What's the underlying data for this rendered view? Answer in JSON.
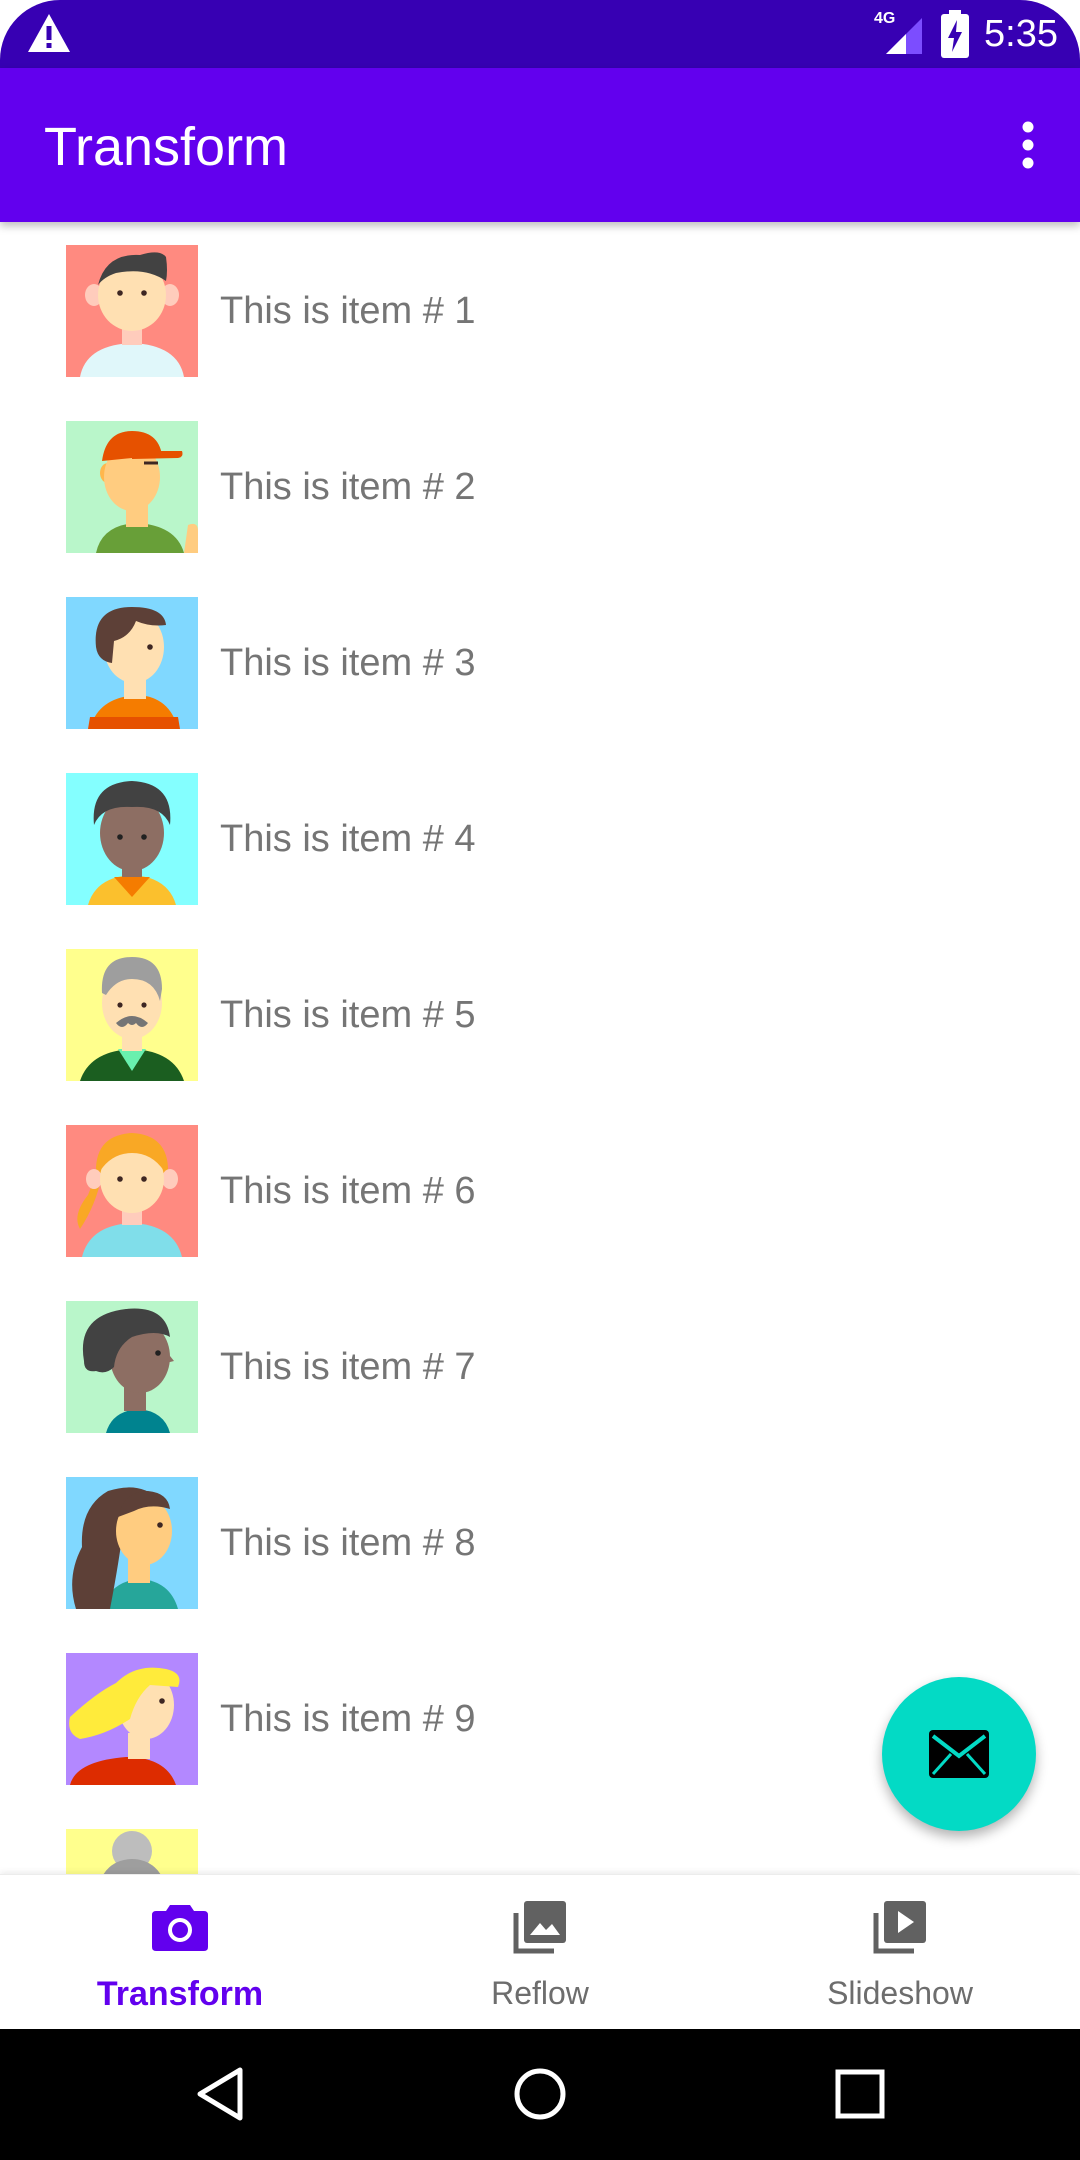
{
  "status_bar": {
    "time": "5:35",
    "network": "4G"
  },
  "app_bar": {
    "title": "Transform"
  },
  "list_items": [
    {
      "label": "This is item # 1",
      "bg": "#ff8a80"
    },
    {
      "label": "This is item # 2",
      "bg": "#b9f6ca"
    },
    {
      "label": "This is item # 3",
      "bg": "#80d8ff"
    },
    {
      "label": "This is item # 4",
      "bg": "#84ffff"
    },
    {
      "label": "This is item # 5",
      "bg": "#ffff8d"
    },
    {
      "label": "This is item # 6",
      "bg": "#ff8a80"
    },
    {
      "label": "This is item # 7",
      "bg": "#b9f6ca"
    },
    {
      "label": "This is item # 8",
      "bg": "#80d8ff"
    },
    {
      "label": "This is item # 9",
      "bg": "#b388ff"
    },
    {
      "label": "",
      "bg": "#ffff8d"
    }
  ],
  "bottom_nav": {
    "tabs": [
      {
        "label": "Transform",
        "icon": "camera-icon",
        "active": true
      },
      {
        "label": "Reflow",
        "icon": "photo-library-icon",
        "active": false
      },
      {
        "label": "Slideshow",
        "icon": "video-library-icon",
        "active": false
      }
    ]
  },
  "colors": {
    "primary": "#6200ee",
    "primary_dark": "#3700b3",
    "accent": "#03dac5"
  }
}
